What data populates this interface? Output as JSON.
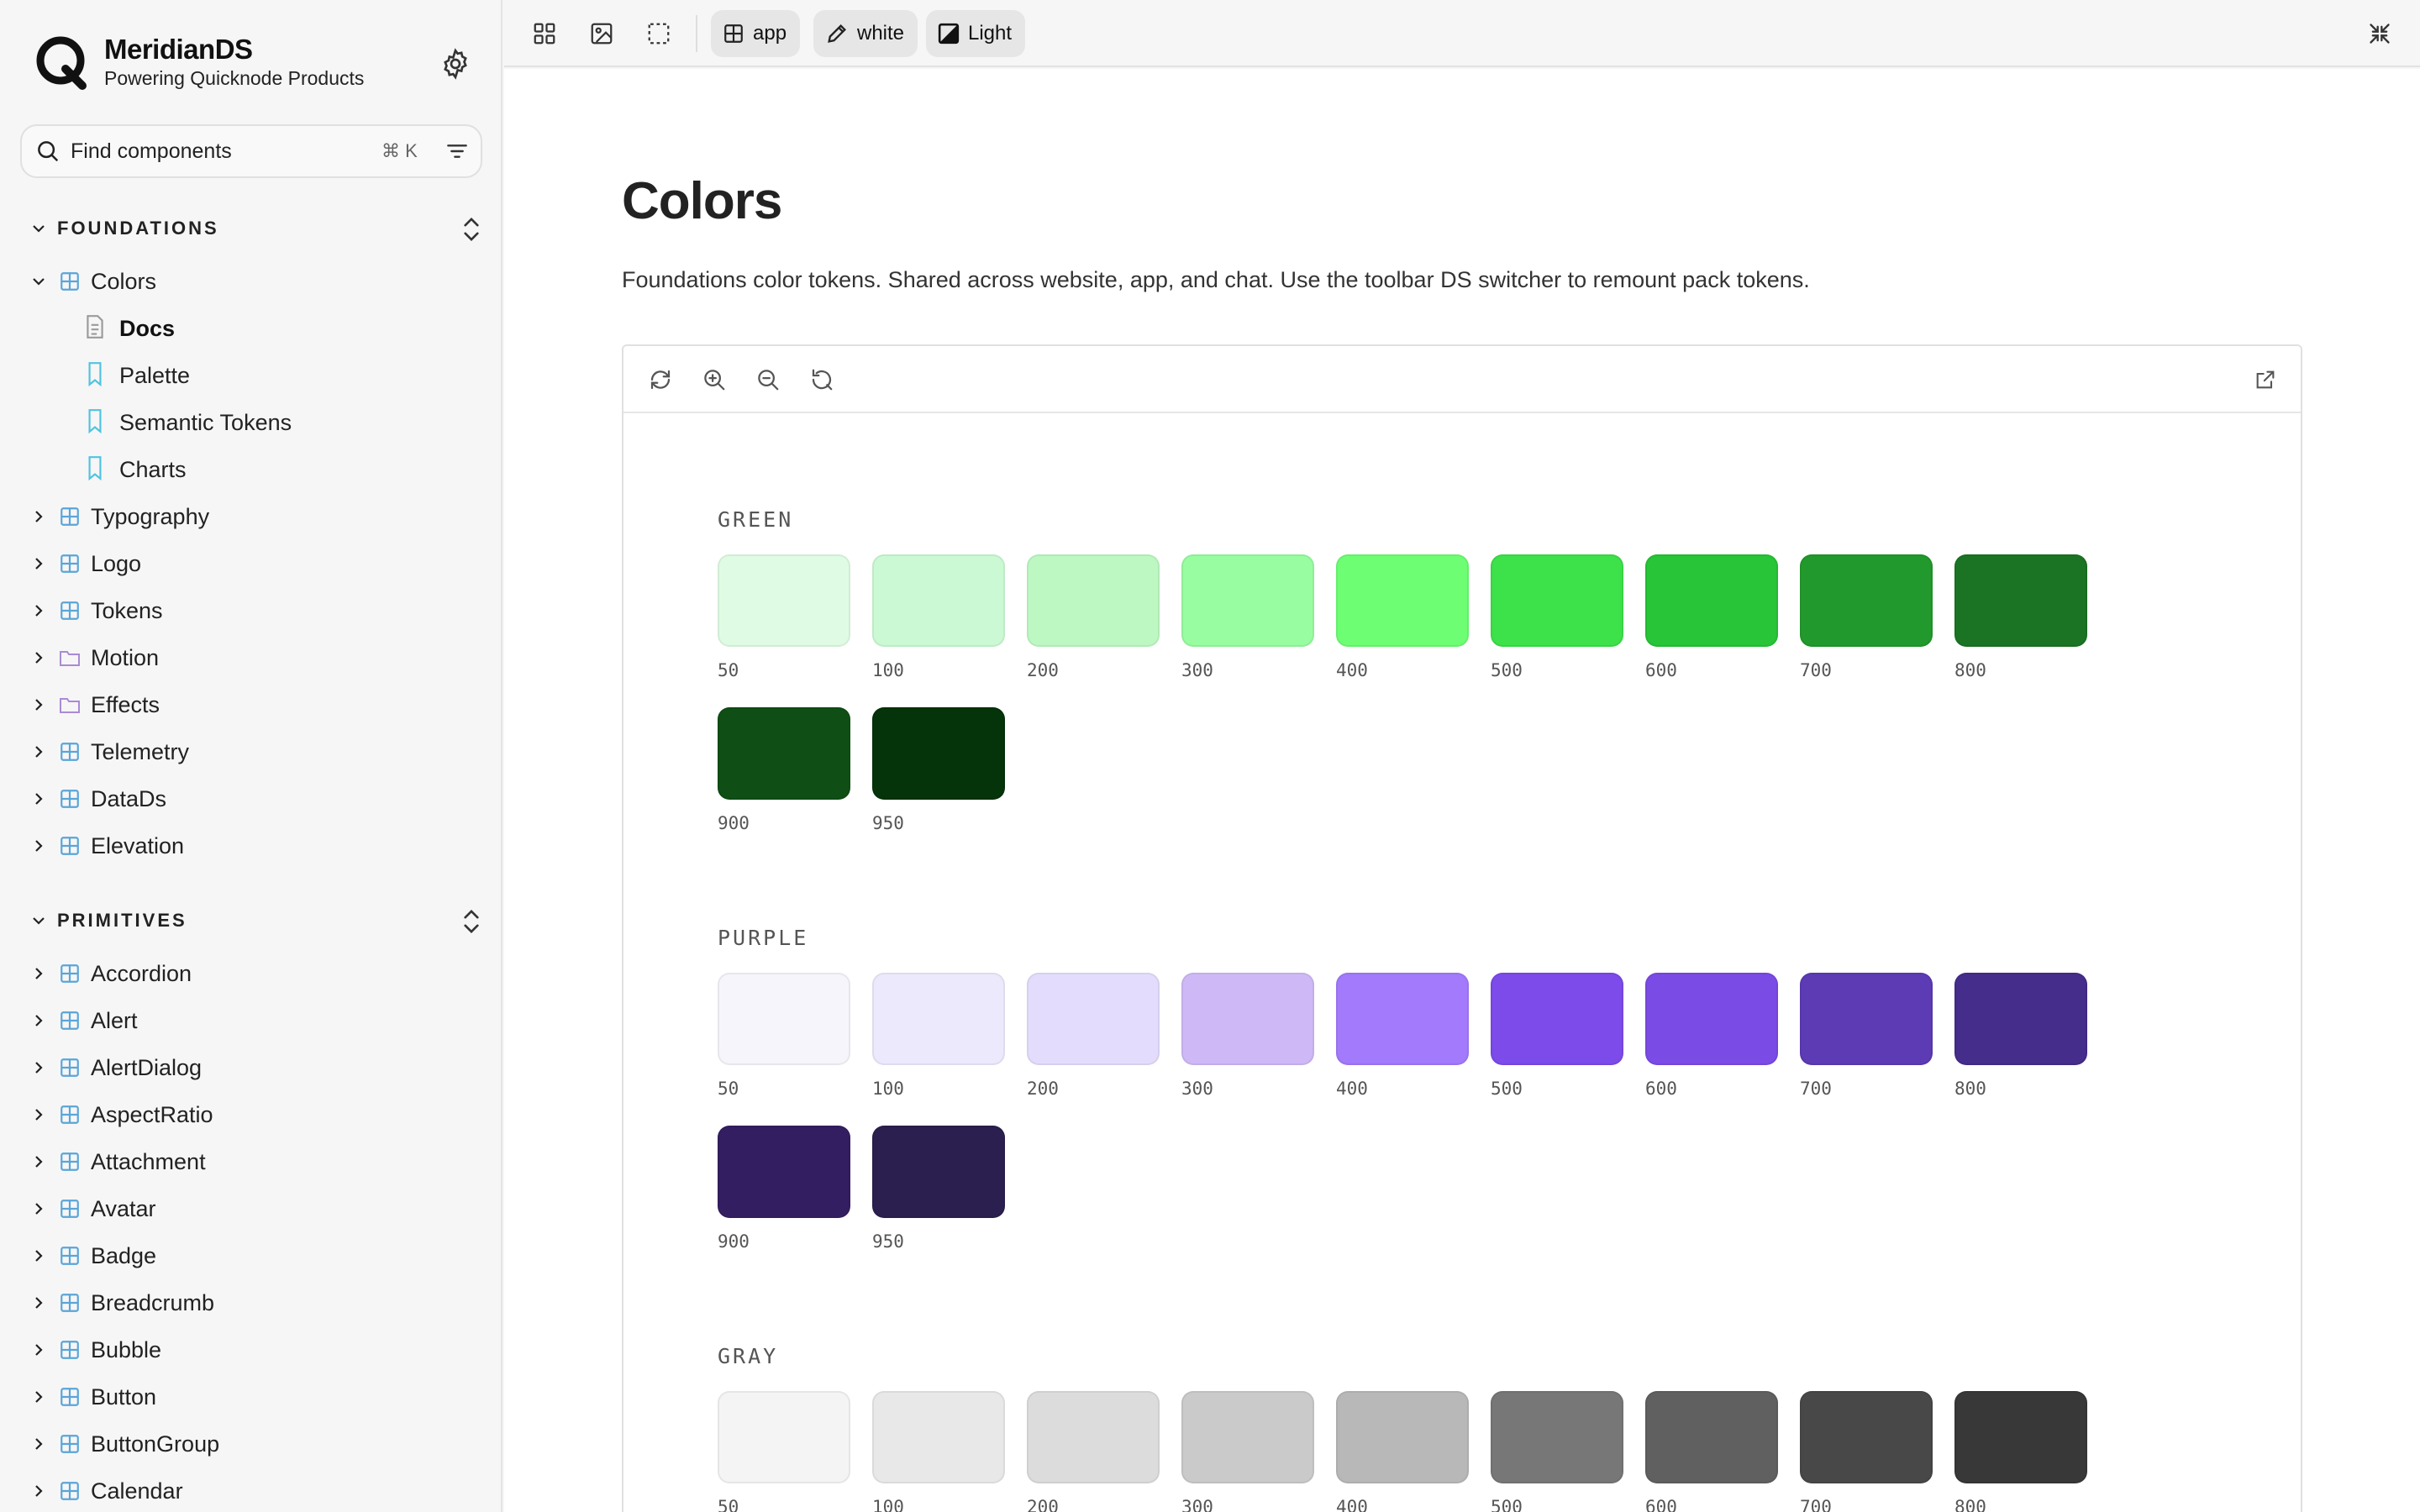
{
  "brand": {
    "title": "MeridianDS",
    "subtitle": "Powering Quicknode Products"
  },
  "search": {
    "placeholder": "Find components",
    "shortcut": "⌘ K"
  },
  "sidebar": {
    "foundations": {
      "label": "FOUNDATIONS",
      "items": [
        {
          "label": "Colors",
          "expanded": true,
          "icon": "component-icon",
          "children": [
            {
              "label": "Docs",
              "icon": "doc-icon",
              "active": true
            },
            {
              "label": "Palette",
              "icon": "story-icon"
            },
            {
              "label": "Semantic Tokens",
              "icon": "story-icon"
            },
            {
              "label": "Charts",
              "icon": "story-icon"
            }
          ]
        },
        {
          "label": "Typography",
          "icon": "component-icon"
        },
        {
          "label": "Logo",
          "icon": "component-icon"
        },
        {
          "label": "Tokens",
          "icon": "component-icon"
        },
        {
          "label": "Motion",
          "icon": "folder-icon"
        },
        {
          "label": "Effects",
          "icon": "folder-icon"
        },
        {
          "label": "Telemetry",
          "icon": "component-icon"
        },
        {
          "label": "DataDs",
          "icon": "component-icon"
        },
        {
          "label": "Elevation",
          "icon": "component-icon"
        }
      ]
    },
    "primitives": {
      "label": "PRIMITIVES",
      "items": [
        {
          "label": "Accordion"
        },
        {
          "label": "Alert"
        },
        {
          "label": "AlertDialog"
        },
        {
          "label": "AspectRatio"
        },
        {
          "label": "Attachment"
        },
        {
          "label": "Avatar"
        },
        {
          "label": "Badge"
        },
        {
          "label": "Breadcrumb"
        },
        {
          "label": "Bubble"
        },
        {
          "label": "Button"
        },
        {
          "label": "ButtonGroup"
        },
        {
          "label": "Calendar"
        }
      ]
    }
  },
  "toolbar": {
    "pills": [
      {
        "label": "app",
        "icon": "grid-icon"
      },
      {
        "label": "white",
        "icon": "pen-icon"
      },
      {
        "label": "Light",
        "icon": "contrast-icon"
      }
    ]
  },
  "page": {
    "title": "Colors",
    "description": "Foundations color tokens. Shared across website, app, and chat. Use the toolbar DS switcher to remount pack tokens."
  },
  "palette": [
    {
      "name": "GREEN",
      "shades": [
        {
          "label": "50",
          "color": "#e0fbe3"
        },
        {
          "label": "100",
          "color": "#cbf9d3"
        },
        {
          "label": "200",
          "color": "#bdf8c3"
        },
        {
          "label": "300",
          "color": "#98fca0"
        },
        {
          "label": "400",
          "color": "#6dfe73"
        },
        {
          "label": "500",
          "color": "#3de14a"
        },
        {
          "label": "600",
          "color": "#27c537"
        },
        {
          "label": "700",
          "color": "#22992c"
        },
        {
          "label": "800",
          "color": "#1b7424"
        },
        {
          "label": "900",
          "color": "#0f4f16"
        },
        {
          "label": "950",
          "color": "#05330a"
        }
      ]
    },
    {
      "name": "PURPLE",
      "shades": [
        {
          "label": "50",
          "color": "#f5f5fb"
        },
        {
          "label": "100",
          "color": "#ede9fc"
        },
        {
          "label": "200",
          "color": "#e4dcfc"
        },
        {
          "label": "300",
          "color": "#ceb9f6"
        },
        {
          "label": "400",
          "color": "#a27afb"
        },
        {
          "label": "500",
          "color": "#7c4bea"
        },
        {
          "label": "600",
          "color": "#7b4be6"
        },
        {
          "label": "700",
          "color": "#5c3bb4"
        },
        {
          "label": "800",
          "color": "#452d8b"
        },
        {
          "label": "900",
          "color": "#341e62"
        },
        {
          "label": "950",
          "color": "#2b1f4f"
        }
      ]
    },
    {
      "name": "GRAY",
      "shades": [
        {
          "label": "50",
          "color": "#f4f4f4"
        },
        {
          "label": "100",
          "color": "#e8e8e8"
        },
        {
          "label": "200",
          "color": "#dcdcdc"
        },
        {
          "label": "300",
          "color": "#cacaca"
        },
        {
          "label": "400",
          "color": "#b8b8b8"
        },
        {
          "label": "500",
          "color": "#777777"
        },
        {
          "label": "600",
          "color": "#606060"
        },
        {
          "label": "700",
          "color": "#484848"
        },
        {
          "label": "800",
          "color": "#383838"
        }
      ]
    }
  ],
  "colors": {
    "component_icon": "#5aa5d8",
    "folder_icon": "#a98bd6",
    "story_icon": "#4fc3e0",
    "doc_icon": "#9a9a9a"
  }
}
